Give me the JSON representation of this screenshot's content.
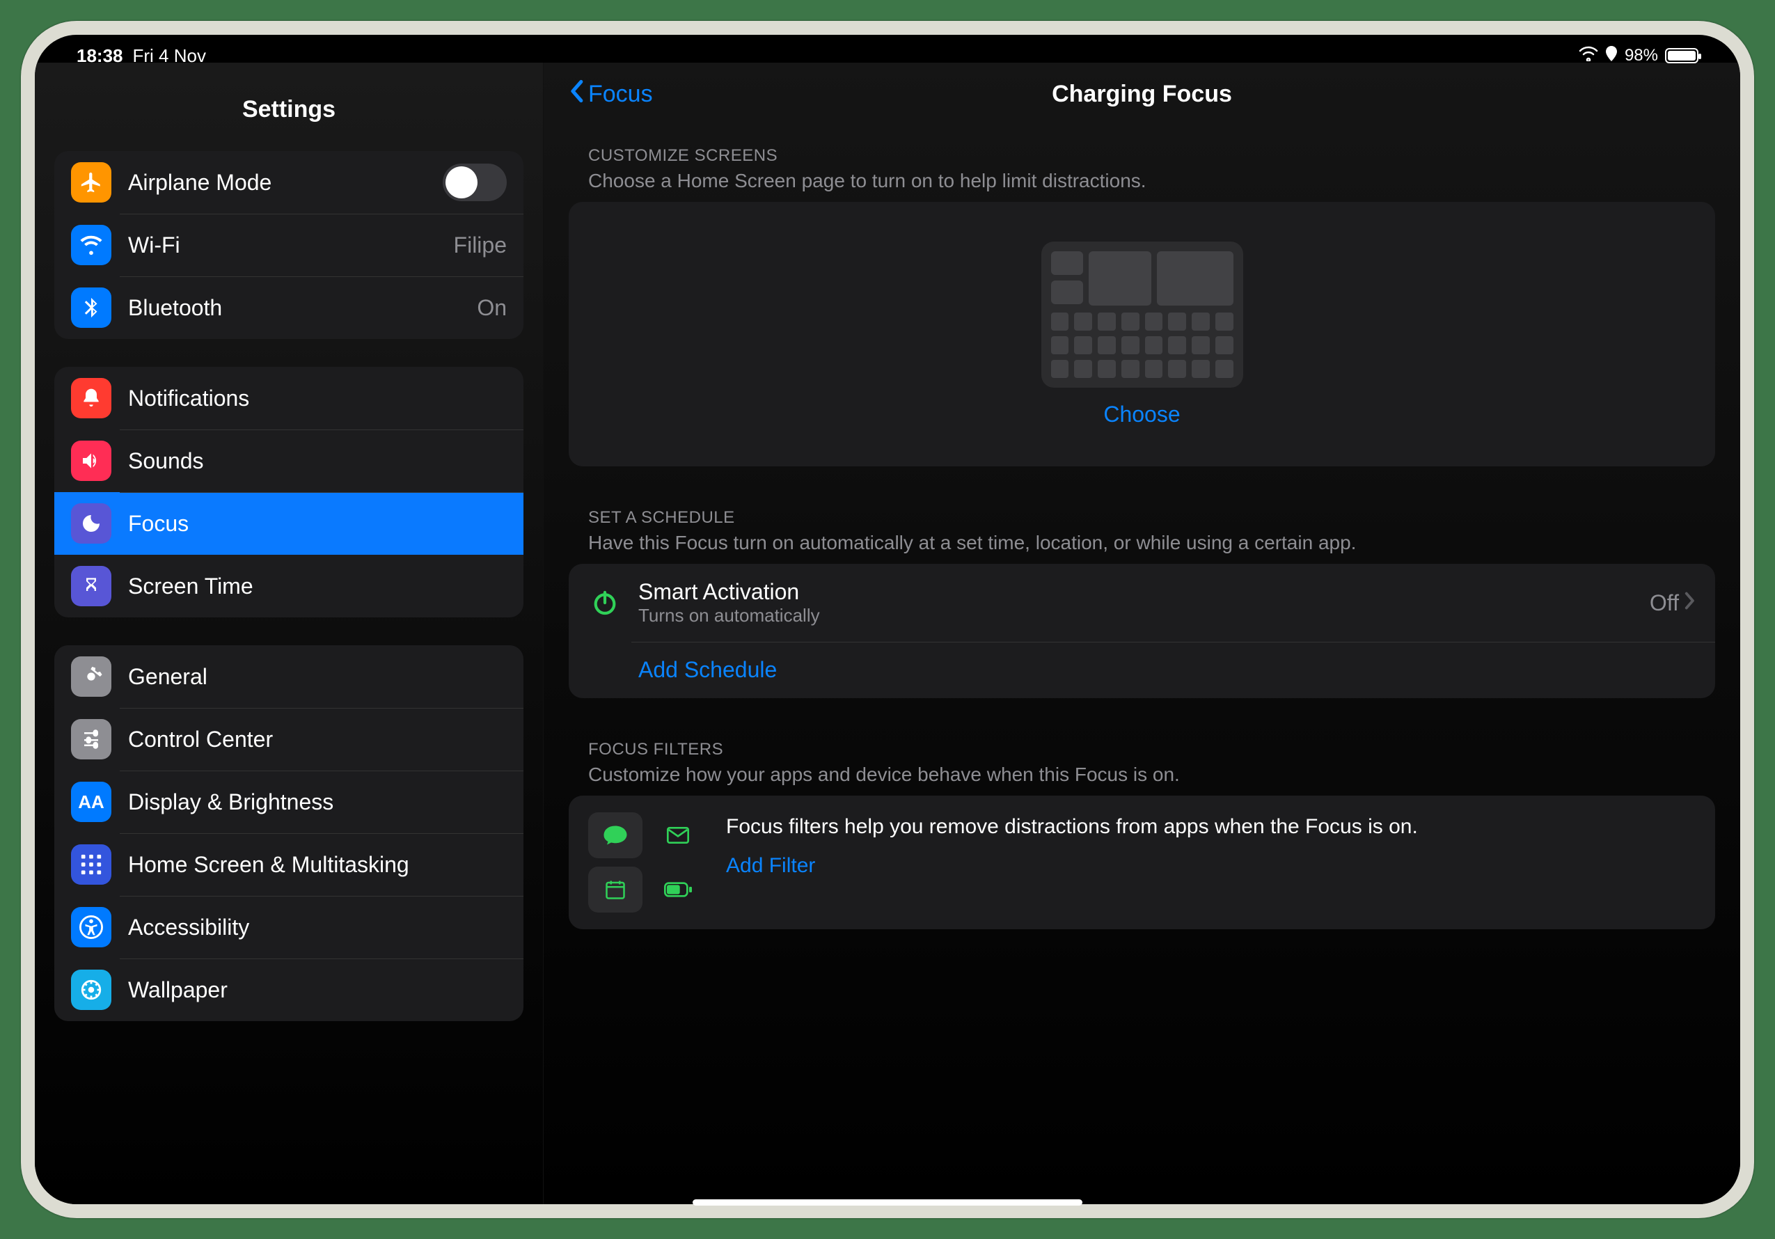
{
  "status": {
    "time": "18:38",
    "date": "Fri 4 Nov",
    "battery_percent": "98%"
  },
  "sidebar": {
    "title": "Settings",
    "groups": [
      {
        "items": [
          {
            "label": "Airplane Mode"
          },
          {
            "label": "Wi-Fi",
            "value": "Filipe"
          },
          {
            "label": "Bluetooth",
            "value": "On"
          }
        ]
      },
      {
        "items": [
          {
            "label": "Notifications"
          },
          {
            "label": "Sounds"
          },
          {
            "label": "Focus"
          },
          {
            "label": "Screen Time"
          }
        ]
      },
      {
        "items": [
          {
            "label": "General"
          },
          {
            "label": "Control Center"
          },
          {
            "label": "Display & Brightness"
          },
          {
            "label": "Home Screen & Multitasking"
          },
          {
            "label": "Accessibility"
          },
          {
            "label": "Wallpaper"
          }
        ]
      }
    ]
  },
  "main": {
    "back_label": "Focus",
    "title": "Charging Focus",
    "customize": {
      "header": "CUSTOMIZE SCREENS",
      "desc": "Choose a Home Screen page to turn on to help limit distractions.",
      "choose": "Choose"
    },
    "schedule": {
      "header": "SET A SCHEDULE",
      "desc": "Have this Focus turn on automatically at a set time, location, or while using a certain app.",
      "smart_title": "Smart Activation",
      "smart_sub": "Turns on automatically",
      "smart_value": "Off",
      "add": "Add Schedule"
    },
    "filters": {
      "header": "FOCUS FILTERS",
      "desc": "Customize how your apps and device behave when this Focus is on.",
      "help": "Focus filters help you remove distractions from apps when the Focus is on.",
      "add": "Add Filter"
    }
  }
}
